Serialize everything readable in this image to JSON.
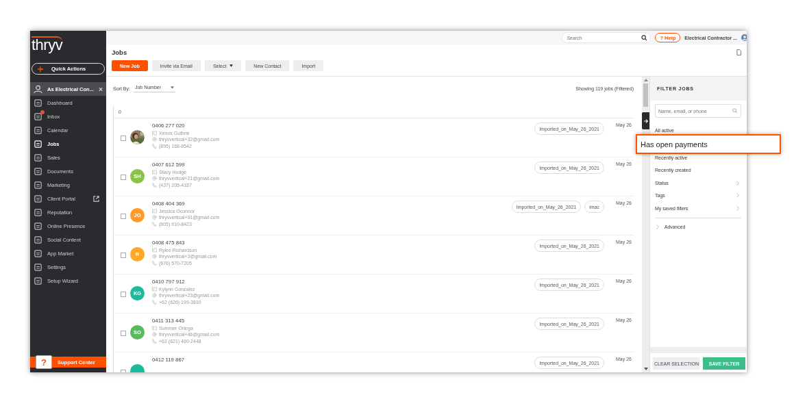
{
  "sidebar": {
    "logo": "thryv",
    "quick_action": "Quick Actions",
    "account": {
      "label": "As Electrical Con...",
      "selected": true
    },
    "items": [
      {
        "label": "Dashboard",
        "selected": false,
        "kind": "plain"
      },
      {
        "label": "Inbox",
        "selected": false,
        "kind": "badge"
      },
      {
        "label": "Calendar",
        "selected": false,
        "kind": "plain"
      },
      {
        "label": "Jobs",
        "selected": true,
        "kind": "plain"
      },
      {
        "label": "Sales",
        "selected": false,
        "kind": "plain"
      },
      {
        "label": "Documents",
        "selected": false,
        "kind": "plain"
      },
      {
        "label": "Marketing",
        "selected": false,
        "kind": "plain"
      },
      {
        "label": "Client Portal",
        "selected": false,
        "kind": "external"
      },
      {
        "label": "Reputation",
        "selected": false,
        "kind": "plain"
      },
      {
        "label": "Online Presence",
        "selected": false,
        "kind": "plain"
      },
      {
        "label": "Social Content",
        "selected": false,
        "kind": "plain"
      },
      {
        "label": "App Market",
        "selected": false,
        "kind": "plain"
      },
      {
        "label": "Settings",
        "selected": false,
        "kind": "plain"
      },
      {
        "label": "Setup Wizard",
        "selected": false,
        "kind": "plain"
      }
    ],
    "support": {
      "icon": "?",
      "label": "Support Center"
    }
  },
  "topbar": {
    "search": {
      "placeholder": "Search"
    },
    "help": {
      "icon": "?",
      "label": "Help"
    },
    "account": "Electrical Contractor ..."
  },
  "page": {
    "title": "Jobs",
    "buttons": [
      {
        "label": "New Job",
        "kind": "primary"
      },
      {
        "label": "Invite via Email",
        "kind": "secondary"
      },
      {
        "label": "Select",
        "kind": "dropdown"
      },
      {
        "label": "New Contact",
        "kind": "secondary"
      },
      {
        "label": "Import",
        "kind": "secondary"
      }
    ]
  },
  "list": {
    "sort_label": "Sort By:",
    "sort_value": "Job Number",
    "count": "Showing 119 jobs (Filtered)",
    "group": "0",
    "rows": [
      {
        "number": "0406 277 020",
        "name": "Xenos Guthrie",
        "email": "thryvvertical+32@gmail.com",
        "phone": "(895) 168-8542",
        "avatar": {
          "kind": "picture"
        },
        "tags": [
          "Imported_on_May_26_2021"
        ],
        "date": "May 26",
        "checked": false
      },
      {
        "number": "0407 612 599",
        "name": "Stacy Hodge",
        "email": "thryvvertical+21@gmail.com",
        "phone": "(437) 205-4187",
        "avatar": {
          "kind": "initials",
          "initials": "SH",
          "color": "#8bc34a"
        },
        "tags": [
          "Imported_on_May_26_2021"
        ],
        "date": "May 26",
        "checked": false
      },
      {
        "number": "0408 404 369",
        "name": "Jessica Oconnor",
        "email": "thryvvertical+91@gmail.com",
        "phone": "(805) 910-8423",
        "avatar": {
          "kind": "initials",
          "initials": "JO",
          "color": "#ff9b26"
        },
        "tags": [
          "Imported_on_May_26_2021",
          "imac"
        ],
        "date": "May 26",
        "checked": false
      },
      {
        "number": "0408 475 843",
        "name": "Rylee Richardson",
        "email": "thryvvertical+3@gmail.com",
        "phone": "(676) 570-7205",
        "avatar": {
          "kind": "initials",
          "initials": "R",
          "color": "#ffa726"
        },
        "tags": [
          "Imported_on_May_26_2021"
        ],
        "date": "May 26",
        "checked": false
      },
      {
        "number": "0410 797 912",
        "name": "Kylynn Gonzalez",
        "email": "thryvvertical+23@gmail.com",
        "phone": "+62 (626) 199-3810",
        "avatar": {
          "kind": "initials",
          "initials": "KG",
          "color": "#1abc9c"
        },
        "tags": [
          "Imported_on_May_26_2021"
        ],
        "date": "May 26",
        "checked": false
      },
      {
        "number": "0411 313 445",
        "name": "Summer Ortega",
        "email": "thryvvertical+46@gmail.com",
        "phone": "+62 (621) 460-2448",
        "avatar": {
          "kind": "initials",
          "initials": "SO",
          "color": "#5cb85c"
        },
        "tags": [
          "Imported_on_May_26_2021"
        ],
        "date": "May 26",
        "checked": false
      },
      {
        "number": "0412 119 867",
        "avatar": {
          "kind": "initials",
          "color": "#1abc9c"
        },
        "tags": [
          "Imported_on_May_26_2021"
        ],
        "date": "May 26",
        "checked": false
      }
    ]
  },
  "filter": {
    "title": "FILTER JOBS",
    "search": {
      "placeholder": "Name, email, or phone"
    },
    "items": [
      {
        "label": "All active",
        "kind": "plain"
      },
      {
        "label": "Recently active",
        "kind": "plain"
      },
      {
        "label": "Recently created",
        "kind": "plain"
      },
      {
        "label": "Status",
        "kind": "submenu"
      },
      {
        "label": "Tags",
        "kind": "submenu"
      },
      {
        "label": "My saved filters",
        "kind": "submenu"
      }
    ],
    "advanced": "Advanced",
    "clear": "CLEAR SELECTION",
    "save": "SAVE FILTER"
  },
  "callout": "Has open payments"
}
